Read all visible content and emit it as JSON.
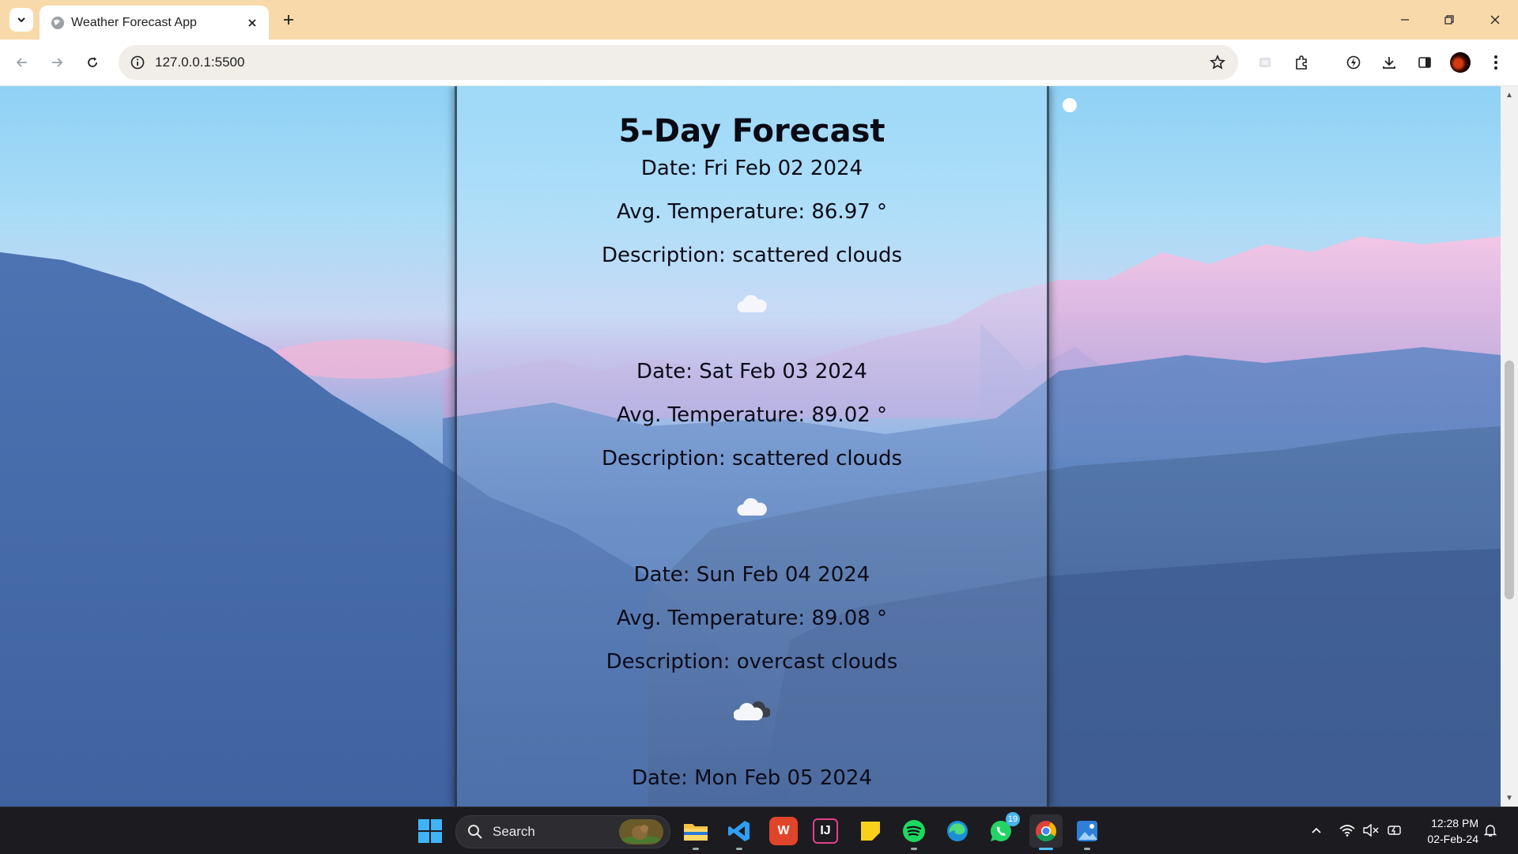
{
  "browser": {
    "tab_title": "Weather Forecast App",
    "url": "127.0.0.1:5500"
  },
  "page": {
    "title": "5-Day Forecast",
    "forecast": [
      {
        "date": "Date: Fri Feb 02 2024",
        "temperature": "Avg. Temperature: 86.97 °",
        "description": "Description: scattered clouds",
        "icon": "cloud-icon"
      },
      {
        "date": "Date: Sat Feb 03 2024",
        "temperature": "Avg. Temperature: 89.02 °",
        "description": "Description: scattered clouds",
        "icon": "cloud-icon"
      },
      {
        "date": "Date: Sun Feb 04 2024",
        "temperature": "Avg. Temperature: 89.08 °",
        "description": "Description: overcast clouds",
        "icon": "overcast-cloud-icon"
      },
      {
        "date": "Date: Mon Feb 05 2024"
      }
    ]
  },
  "taskbar": {
    "search_label": "Search",
    "whatsapp_badge": "19",
    "time": "12:28 PM",
    "date": "02-Feb-24"
  },
  "colors": {
    "tabbar": "#f8d9a9",
    "taskbar": "#1c1c20",
    "accent": "#4cc2ff"
  }
}
